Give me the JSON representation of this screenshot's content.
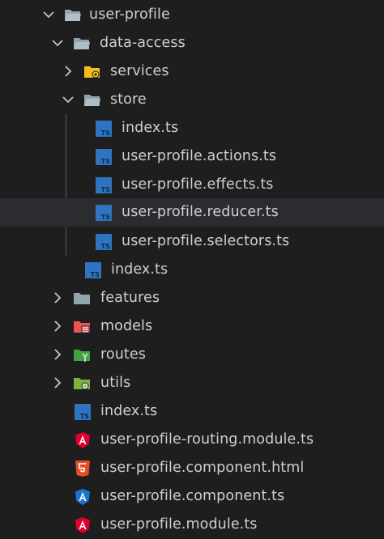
{
  "explorer": {
    "root": {
      "label": "user-profile",
      "icon": "folder-open-icon",
      "expanded": true
    },
    "data_access": {
      "label": "data-access",
      "icon": "folder-open-icon",
      "expanded": true
    },
    "services": {
      "label": "services",
      "icon": "services-folder-icon",
      "expanded": false
    },
    "store": {
      "label": "store",
      "icon": "folder-open-icon",
      "expanded": true
    },
    "store_files": [
      {
        "label": "index.ts",
        "icon": "typescript-file-icon"
      },
      {
        "label": "user-profile.actions.ts",
        "icon": "typescript-file-icon"
      },
      {
        "label": "user-profile.effects.ts",
        "icon": "typescript-file-icon"
      },
      {
        "label": "user-profile.reducer.ts",
        "icon": "typescript-file-icon",
        "selected": true
      },
      {
        "label": "user-profile.selectors.ts",
        "icon": "typescript-file-icon"
      }
    ],
    "data_access_index": {
      "label": "index.ts",
      "icon": "typescript-file-icon"
    },
    "features": {
      "label": "features",
      "icon": "folder-icon",
      "expanded": false
    },
    "models": {
      "label": "models",
      "icon": "models-folder-icon",
      "expanded": false
    },
    "routes": {
      "label": "routes",
      "icon": "routes-folder-icon",
      "expanded": false
    },
    "utils": {
      "label": "utils",
      "icon": "utils-folder-icon",
      "expanded": false
    },
    "root_files": [
      {
        "label": "index.ts",
        "icon": "typescript-file-icon"
      },
      {
        "label": "user-profile-routing.module.ts",
        "icon": "angular-red-icon"
      },
      {
        "label": "user-profile.component.html",
        "icon": "html5-icon"
      },
      {
        "label": "user-profile.component.ts",
        "icon": "angular-blue-icon"
      },
      {
        "label": "user-profile.module.ts",
        "icon": "angular-red-icon"
      }
    ]
  },
  "colors": {
    "background": "#1e1e1e",
    "selected_row": "#2b2c30",
    "text": "#cfcfcf",
    "folder": "#90a4ae",
    "typescript": "#2f74c0",
    "services_folder": "#f9bd1b",
    "models_folder": "#ef5350",
    "routes_folder": "#43a047",
    "utils_folder": "#7cb342",
    "angular_red": "#dd0031",
    "angular_blue": "#1976d2",
    "html5": "#e44d26"
  }
}
